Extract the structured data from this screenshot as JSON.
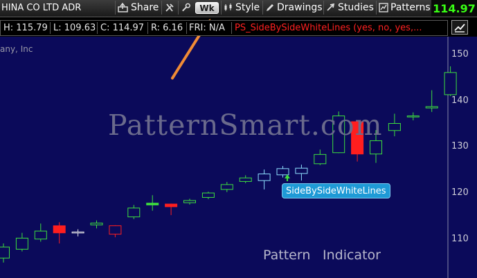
{
  "toolbar": {
    "symbol_name": "HINA CO LTD ADR",
    "share_label": "Share",
    "wk_label": "Wk",
    "style_label": "Style",
    "drawings_label": "Drawings",
    "studies_label": "Studies",
    "patterns_label": "Patterns",
    "last_price": "114.97",
    "icons": [
      "share-icon",
      "tools-icon",
      "wrench-icon",
      "style-icon",
      "drawings-icon",
      "studies-icon",
      "patterns-icon"
    ]
  },
  "infobar": {
    "high": "H: 115.79",
    "low": "L: 109.63",
    "close": "C: 114.97",
    "range": "R: 6.16",
    "fri": "FRI: N/A",
    "study": "PS_SideBySideWhiteLines (yes, no, yes,...",
    "settings_icon": "chart-settings-icon"
  },
  "chart": {
    "company_fragment": "any, Inc",
    "watermark": "PatternSmart.com",
    "pattern_tag": "SideBySideWhiteLines",
    "caption_pattern": "Pattern",
    "caption_indicator": "Indicator"
  },
  "colors": {
    "background": "#0b0a5a",
    "up_candle": "#3ee03e",
    "down_candle": "#ff1e1e",
    "pattern_candle": "#8fe0ff",
    "doji_candle": "#e8e8e8",
    "price_text": "#39ff14",
    "study_text": "#ff2020",
    "arrow": "#f08b35",
    "tag_bg": "#1e9ad6"
  },
  "chart_data": {
    "type": "candlestick",
    "y_ticks": [
      150,
      140,
      130,
      120,
      110
    ],
    "ylim": [
      103,
      157.5
    ],
    "candles": [
      {
        "o": 107.5,
        "h": 110.8,
        "l": 106.5,
        "c": 110.0,
        "kind": "up"
      },
      {
        "o": 109.5,
        "h": 113.2,
        "l": 109.0,
        "c": 112.0,
        "kind": "up"
      },
      {
        "o": 111.8,
        "h": 115.3,
        "l": 111.2,
        "c": 113.6,
        "kind": "up"
      },
      {
        "o": 114.8,
        "h": 115.6,
        "l": 110.8,
        "c": 113.2,
        "kind": "down-solid"
      },
      {
        "o": 113.4,
        "h": 114.0,
        "l": 112.4,
        "c": 113.4,
        "kind": "doji"
      },
      {
        "o": 115.0,
        "h": 116.0,
        "l": 114.2,
        "c": 115.4,
        "kind": "up"
      },
      {
        "o": 114.8,
        "h": 114.9,
        "l": 112.2,
        "c": 112.9,
        "kind": "down-hollow"
      },
      {
        "o": 116.8,
        "h": 119.5,
        "l": 116.3,
        "c": 118.8,
        "kind": "up"
      },
      {
        "o": 119.5,
        "h": 121.7,
        "l": 118.2,
        "c": 119.9,
        "kind": "up-solid"
      },
      {
        "o": 119.7,
        "h": 119.8,
        "l": 117.2,
        "c": 119.1,
        "kind": "down-solid"
      },
      {
        "o": 120.0,
        "h": 120.9,
        "l": 119.6,
        "c": 120.5,
        "kind": "up"
      },
      {
        "o": 121.2,
        "h": 122.5,
        "l": 120.8,
        "c": 122.2,
        "kind": "up"
      },
      {
        "o": 123.0,
        "h": 124.7,
        "l": 122.4,
        "c": 124.1,
        "kind": "up"
      },
      {
        "o": 124.8,
        "h": 126.2,
        "l": 124.4,
        "c": 125.6,
        "kind": "up"
      },
      {
        "o": 125.0,
        "h": 127.5,
        "l": 123.0,
        "c": 126.5,
        "kind": "pattern"
      },
      {
        "o": 126.3,
        "h": 128.3,
        "l": 125.7,
        "c": 127.7,
        "kind": "pattern"
      },
      {
        "o": 126.6,
        "h": 128.6,
        "l": 125.0,
        "c": 127.8,
        "kind": "pattern"
      },
      {
        "o": 128.8,
        "h": 132.0,
        "l": 128.5,
        "c": 130.9,
        "kind": "up"
      },
      {
        "o": 131.3,
        "h": 140.6,
        "l": 131.2,
        "c": 139.6,
        "kind": "up"
      },
      {
        "o": 138.3,
        "h": 138.4,
        "l": 129.3,
        "c": 131.0,
        "kind": "down-solid"
      },
      {
        "o": 131.0,
        "h": 136.4,
        "l": 129.0,
        "c": 134.0,
        "kind": "up"
      },
      {
        "o": 136.3,
        "h": 140.1,
        "l": 135.0,
        "c": 137.9,
        "kind": "up"
      },
      {
        "o": 139.4,
        "h": 140.4,
        "l": 138.6,
        "c": 139.6,
        "kind": "up"
      },
      {
        "o": 141.4,
        "h": 145.4,
        "l": 140.5,
        "c": 141.7,
        "kind": "up"
      },
      {
        "o": 144.4,
        "h": 150.8,
        "l": 144.1,
        "c": 149.4,
        "kind": "up"
      }
    ]
  }
}
